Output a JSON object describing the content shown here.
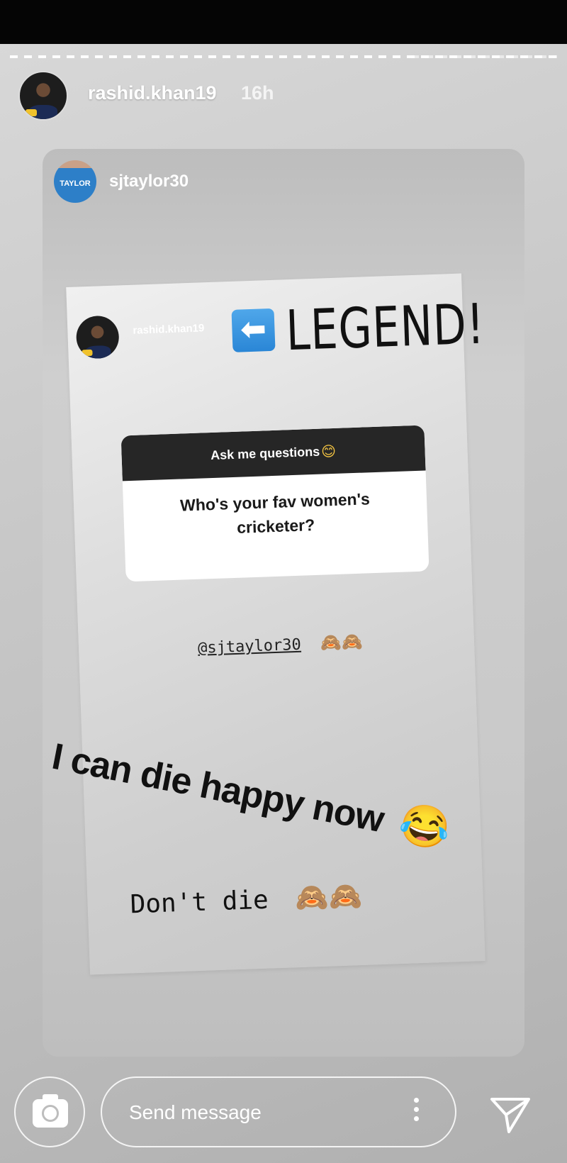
{
  "header": {
    "username": "rashid.khan19",
    "time_ago": "16h"
  },
  "reshared_post": {
    "username": "sjtaylor30",
    "avatar_jersey_text": "TAYLOR"
  },
  "story": {
    "username": "rashid.khan19",
    "arrow_glyph": "⬅",
    "headline": "LEGEND!",
    "question_box": {
      "title": "Ask me questions",
      "title_emoji": "😊",
      "question": "Who's your fav women's cricketer?"
    },
    "mention": "@sjtaylor30",
    "mention_emojis": "🙈🙈",
    "caption": "I can die happy now",
    "caption_emoji": "😂",
    "reply": "Don't die",
    "reply_emojis": "🙈🙈"
  },
  "footer": {
    "message_placeholder": "Send message",
    "icons": [
      "camera-icon",
      "more-options-icon",
      "send-icon"
    ]
  },
  "colors": {
    "background": "#c8c8c8",
    "question_header": "#262626",
    "arrow_button": "#2a86d6"
  }
}
